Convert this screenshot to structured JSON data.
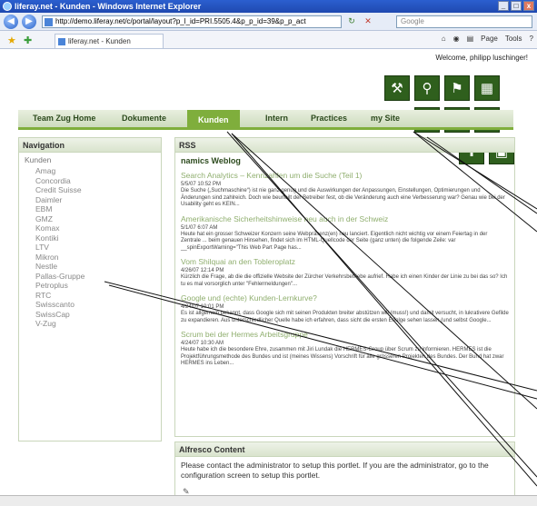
{
  "browser": {
    "title": "liferay.net - Kunden - Windows Internet Explorer",
    "url": "http://demo.liferay.net/c/portal/layout?p_l_id=PRI.5505.4&p_p_id=39&p_p_act",
    "search_placeholder": "Google",
    "tab_title": "liferay.net - Kunden",
    "cmd_page": "Page",
    "cmd_tools": "Tools",
    "win_min": "_",
    "win_max": "□",
    "win_close": "x"
  },
  "header": {
    "welcome": "Welcome, philipp luschinger!"
  },
  "nav_tabs": [
    {
      "label": "Team Zug Home"
    },
    {
      "label": "Dokumente"
    },
    {
      "label": "Kunden",
      "active": true
    },
    {
      "label": "Intern"
    },
    {
      "label": "Practices"
    },
    {
      "label": "my Site"
    }
  ],
  "navigation": {
    "title": "Navigation",
    "root": "Kunden",
    "items": [
      "Amag",
      "Concordia",
      "Credit Suisse",
      "Daimler",
      "EBM",
      "GMZ",
      "Komax",
      "Kontiki",
      "LTV",
      "Mikron",
      "Nestle",
      "Pallas-Gruppe",
      "Petroplus",
      "RTC",
      "Swisscanto",
      "SwissCap",
      "V-Zug"
    ]
  },
  "rss": {
    "title": "RSS",
    "weblog": "namics Weblog",
    "entries": [
      {
        "title": "Search Analytics – Kennzahlen um die Suche (Teil 1)",
        "date": "5/5/07 10:52 PM",
        "text": "Die Suche („Suchmaschine“) ist nie ganz genug und die Auswirkungen der Anpassungen, Einstellungen, Optimierungen und Änderungen sind zahlreich. Doch wie beurteilt der Betreiber fest, ob die Veränderung auch eine Verbesserung war? Genau wie bei der Usability geht es KEIN..."
      },
      {
        "title": "Amerikanische Sicherheitshinweise neu auch in der Schweiz",
        "date": "5/1/07 6:07 AM",
        "text": "Heute hat ein grosser Schweizer Konzern seine Webpräsenz(en) neu lanciert. Eigentlich nicht wichtig vor einem Feiertag in der Zentrale ... beim genauen Hinsehen, findet sich im HTML-Quellcode der Seite (ganz unten) die folgende Zeile: var __spinExportWarning=\"This Web Part Page has..."
      },
      {
        "title": "Vom Shilquai an den Tobleroplatz",
        "date": "4/26/07 12:14 PM",
        "text": "Kürzlich die Frage, ab die die offizielle Website der Zürcher Verkehrsbetriebe aufrief. Habe ich einen Kinder der Linie zu bei das so? Ich tu es mal vorsorglich unter \"Fehlermeldungen\"..."
      },
      {
        "title": "Google und (echte) Kunden-Lernkurve?",
        "date": "4/24/07 10:01 PM",
        "text": "Es ist allgemein bekannt, dass Google sich mit seinen Produkten breiter abstützen will (muss!) und damit versucht, in lukrativere Gefilde zu expandieren. Aus unterschiedlicher Quelle habe ich erfahren, dass sicht die ersten Erfolge sehen lassen (und selbst Google..."
      },
      {
        "title": "Scrum bei der Hermes Arbeitsgruppe",
        "date": "4/24/07 10:30 AM",
        "text": "Heute habe ich die besondere Ehre, zusammen mit Jiri Lundak die HERMES-Group über Scrum zu informieren. HERMES ist die Projektführungsmethode des Bundes und ist (meines Wissens) Vorschrift für alle grösseren Projekten des Bundes. Der Bund hat zwar HERMES ins Leben..."
      }
    ]
  },
  "alfresco": {
    "title": "Alfresco Content",
    "text": "Please contact the administrator to setup this portlet. If you are the administrator, go to the configuration screen to setup this portlet."
  }
}
